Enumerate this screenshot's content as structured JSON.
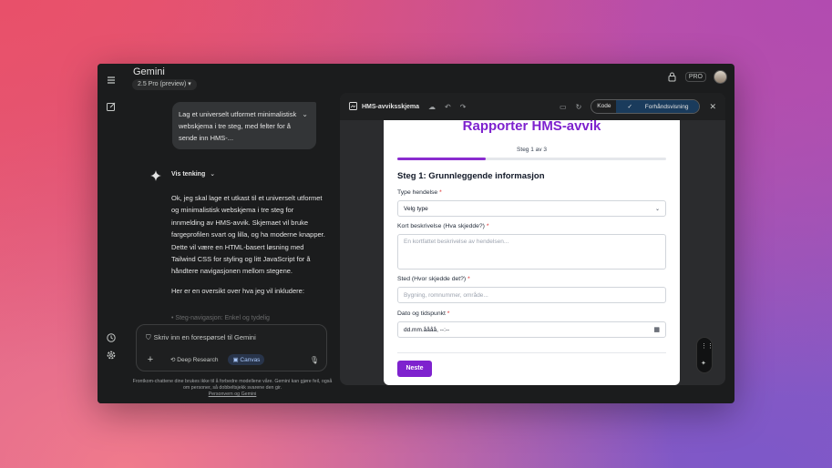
{
  "app": {
    "title": "Gemini",
    "model": "2.5 Pro (preview)",
    "pro_badge": "PRO"
  },
  "rail": {
    "menu_icon": "menu-icon",
    "new_chat_icon": "edit-icon",
    "history_icon": "history-icon",
    "settings_icon": "gear-icon"
  },
  "chat": {
    "user_message": "Lag et universelt utformet minimalistisk webskjema i tre steg, med felter for å sende inn HMS-...",
    "thinking_label": "Vis tenking",
    "reply_paragraphs": [
      "Ok, jeg skal lage et utkast til et universelt utformet og minimalistisk webskjema i tre steg for innmelding av HMS-avvik. Skjemaet vil bruke fargeprofilen svart og lilla, og ha moderne knapper. Dette vil være en HTML-basert løsning med Tailwind CSS for styling og litt JavaScript for å håndtere navigasjonen mellom stegene.",
      "Her er en oversikt over hva jeg vil inkludere:"
    ],
    "reply_faded": "• Steg-navigasjon: Enkel og tydelig"
  },
  "prompt": {
    "placeholder": "Skriv inn en forespørsel til Gemini",
    "deep_research": "Deep Research",
    "canvas": "Canvas",
    "disclaimer": "Frontkom-chattene dine brukes ikke til å forbedre modellene våre. Gemini kan gjøre feil, også om personer, så dobbeltsjekk svarene den gir.",
    "privacy_link": "Personvern og Gemini"
  },
  "canvas": {
    "title": "HMS-avviksskjema",
    "code_tab": "Kode",
    "preview_tab": "Forhåndsvisning"
  },
  "form": {
    "heading": "Rapporter HMS-avvik",
    "step_label": "Steg 1 av 3",
    "progress": 0.33,
    "step_title": "Steg 1: Grunnleggende informasjon",
    "type_label": "Type hendelse",
    "type_value": "Velg type",
    "desc_label": "Kort beskrivelse (Hva skjedde?)",
    "desc_placeholder": "En kortfattet beskrivelse av hendelsen...",
    "place_label": "Sted (Hvor skjedde det?)",
    "place_placeholder": "Bygning, romnummer, område...",
    "date_label": "Dato og tidspunkt",
    "date_value": "dd.mm.åååå, --:--",
    "required_mark": "*",
    "next_button": "Neste"
  },
  "colors": {
    "accent": "#7e22ce",
    "canvas_active": "#a8c7fa",
    "window_bg": "#1b1c1d"
  }
}
